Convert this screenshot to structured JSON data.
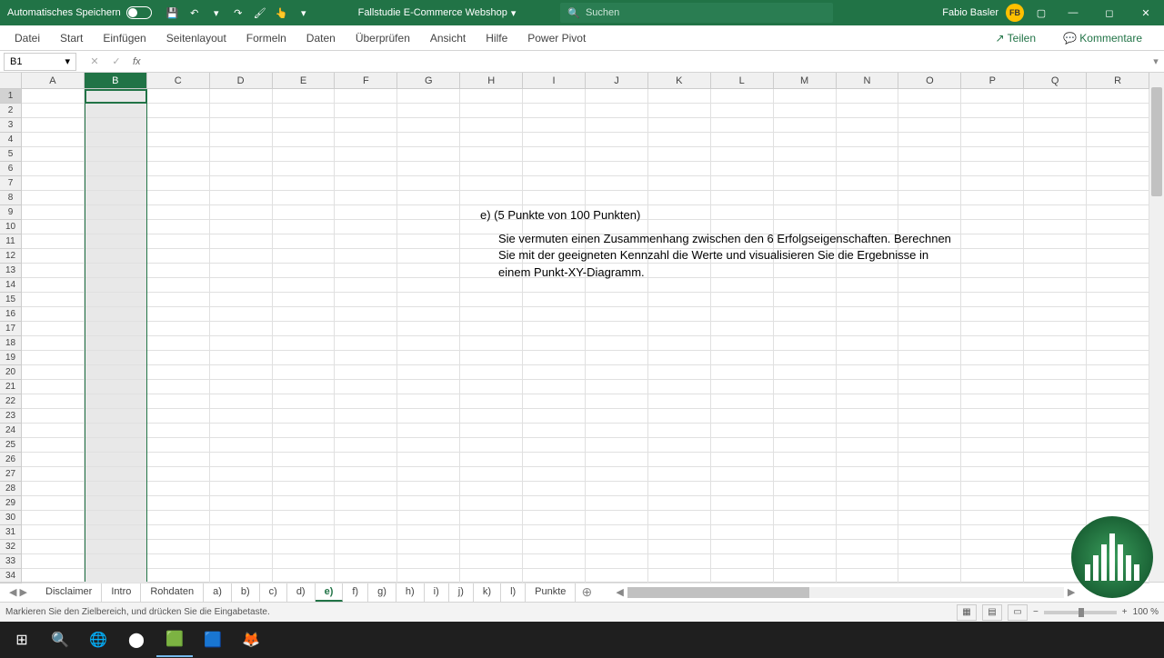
{
  "titlebar": {
    "autosave_label": "Automatisches Speichern",
    "doc_title": "Fallstudie E-Commerce Webshop",
    "search_placeholder": "Suchen",
    "user_name": "Fabio Basler",
    "user_initials": "FB"
  },
  "ribbon": {
    "tabs": [
      "Datei",
      "Start",
      "Einfügen",
      "Seitenlayout",
      "Formeln",
      "Daten",
      "Überprüfen",
      "Ansicht",
      "Hilfe",
      "Power Pivot"
    ],
    "share": "Teilen",
    "comments": "Kommentare"
  },
  "formula": {
    "cell_ref": "B1",
    "fx_label": "fx",
    "value": ""
  },
  "columns": [
    "A",
    "B",
    "C",
    "D",
    "E",
    "F",
    "G",
    "H",
    "I",
    "J",
    "K",
    "L",
    "M",
    "N",
    "O",
    "P",
    "Q",
    "R"
  ],
  "selected_column_index": 1,
  "row_count": 34,
  "task_text": {
    "heading": "e) (5 Punkte von 100 Punkten)",
    "body": "Sie vermuten einen Zusammenhang zwischen den 6 Erfolgseigenschaften. Berechnen Sie mit der geeigneten Kennzahl die Werte und visualisieren Sie die Ergebnisse in einem Punkt-XY-Diagramm."
  },
  "sheets": [
    "Disclaimer",
    "Intro",
    "Rohdaten",
    "a)",
    "b)",
    "c)",
    "d)",
    "e)",
    "f)",
    "g)",
    "h)",
    "i)",
    "j)",
    "k)",
    "l)",
    "Punkte"
  ],
  "active_sheet": "e)",
  "statusbar": {
    "message": "Markieren Sie den Zielbereich, und drücken Sie die Eingabetaste.",
    "zoom": "100 %"
  },
  "icons": {
    "save": "💾",
    "undo": "↶",
    "redo": "↷",
    "brush": "🖌",
    "touch": "👆",
    "dropdown": "▾",
    "search": "🔍",
    "ribbon_opts": "▢",
    "minimize": "—",
    "maximize": "◻",
    "close": "✕",
    "share": "↗",
    "comment": "💬",
    "cancel": "✕",
    "confirm": "✓",
    "windows": "⊞",
    "cortana": "○",
    "obs": "⬤",
    "excel": "🟩",
    "word": "🟦",
    "firefox": "🦊",
    "app": "🌐"
  }
}
